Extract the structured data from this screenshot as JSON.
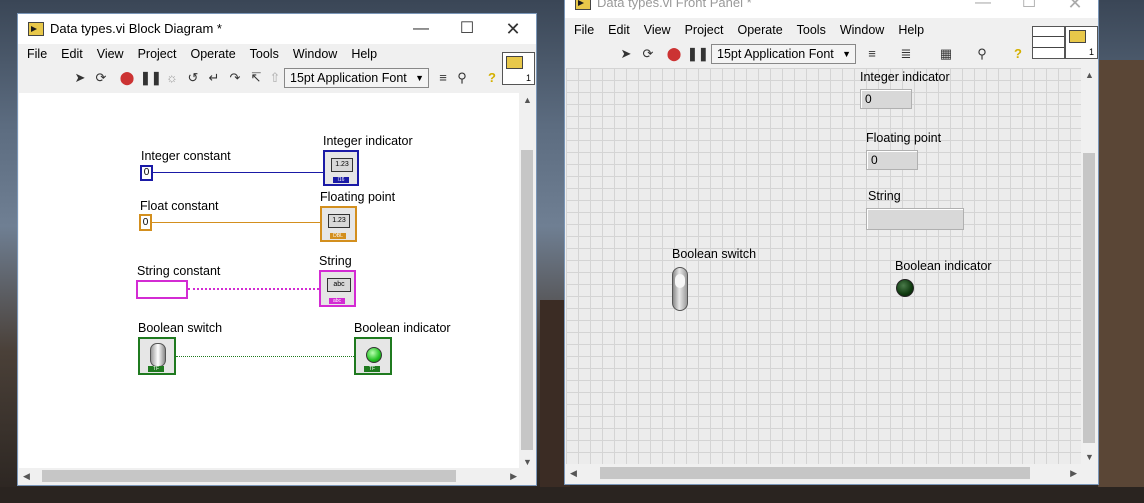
{
  "block_diagram": {
    "title": "Data types.vi Block Diagram *",
    "menu": [
      "File",
      "Edit",
      "View",
      "Project",
      "Operate",
      "Tools",
      "Window",
      "Help"
    ],
    "font_selector": "15pt Application Font",
    "icon_number": "1",
    "labels": {
      "int_const": "Integer constant",
      "int_ind": "Integer indicator",
      "float_const": "Float constant",
      "float_ind": "Floating point",
      "str_const": "String constant",
      "str_ind": "String",
      "bool_sw": "Boolean switch",
      "bool_ind": "Boolean indicator"
    },
    "values": {
      "int_const": "0",
      "float_const": "0",
      "int_ind_type": "1.23",
      "float_ind_type": "1.23",
      "str_ind_type": "abc",
      "bool_tag": "TF"
    },
    "colors": {
      "int": "#1a1aa6",
      "float": "#d38f1e",
      "string": "#d32bd3",
      "bool": "#1f7a1f"
    }
  },
  "front_panel": {
    "title": "Data types.vi Front Panel *",
    "menu": [
      "File",
      "Edit",
      "View",
      "Project",
      "Operate",
      "Tools",
      "Window",
      "Help"
    ],
    "font_selector": "15pt Application Font",
    "icon_number": "1",
    "labels": {
      "int_ind": "Integer indicator",
      "float_ind": "Floating point",
      "str_ind": "String",
      "bool_sw": "Boolean switch",
      "bool_ind": "Boolean indicator"
    },
    "values": {
      "int_ind": "0",
      "float_ind": "0",
      "str_ind": ""
    }
  }
}
